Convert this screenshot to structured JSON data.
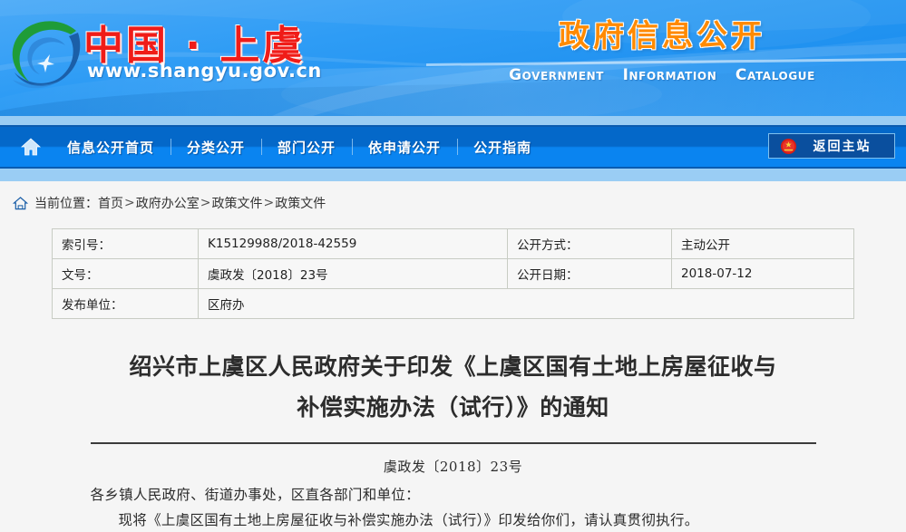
{
  "banner": {
    "logo_icon": "shangyu-swirl-logo",
    "site_title_cn": "中国 · 上虞",
    "site_url": "www.shangyu.gov.cn",
    "gov_title_cn": "政府信息公开",
    "gov_title_en_words": [
      "Government",
      "Information",
      "Catalogue"
    ],
    "colors": {
      "banner_blue": "#2e9cf5",
      "title_red": "#f01c18",
      "gov_title_orange": "#ff8a00"
    }
  },
  "nav": {
    "home_icon": "home-icon",
    "items": [
      {
        "label": "信息公开首页"
      },
      {
        "label": "分类公开"
      },
      {
        "label": "部门公开"
      },
      {
        "label": "依申请公开"
      },
      {
        "label": "公开指南"
      }
    ],
    "return_button": {
      "label": "返回主站",
      "icon": "national-emblem-icon"
    },
    "colors": {
      "nav_blue": "#0468c9",
      "nav_blue_light": "#0a84f0",
      "band_light": "#9acdf4"
    }
  },
  "breadcrumb": {
    "home_icon": "home-outline-icon",
    "label": "当前位置：",
    "items": [
      "首页",
      "政府办公室",
      "政策文件",
      "政策文件"
    ],
    "separator": ">"
  },
  "meta": {
    "rows": [
      {
        "k1": "索引号：",
        "v1": "K15129988/2018-42559",
        "k2": "公开方式：",
        "v2": "主动公开"
      },
      {
        "k1": "文号：",
        "v1": "虞政发〔2018〕23号",
        "k2": "公开日期：",
        "v2": "2018-07-12"
      },
      {
        "k1": "发布单位：",
        "v1": "区府办",
        "k2": "",
        "v2": ""
      }
    ]
  },
  "document": {
    "title_line1": "绍兴市上虞区人民政府关于印发《上虞区国有土地上房屋征收与",
    "title_line2": "补偿实施办法（试行）》的通知",
    "doc_number": "虞政发〔2018〕23号",
    "paragraphs": [
      "各乡镇人民政府、街道办事处，区直各部门和单位：",
      "现将《上虞区国有土地上房屋征收与补偿实施办法（试行）》印发给你们，请认真贯彻执行。"
    ]
  }
}
